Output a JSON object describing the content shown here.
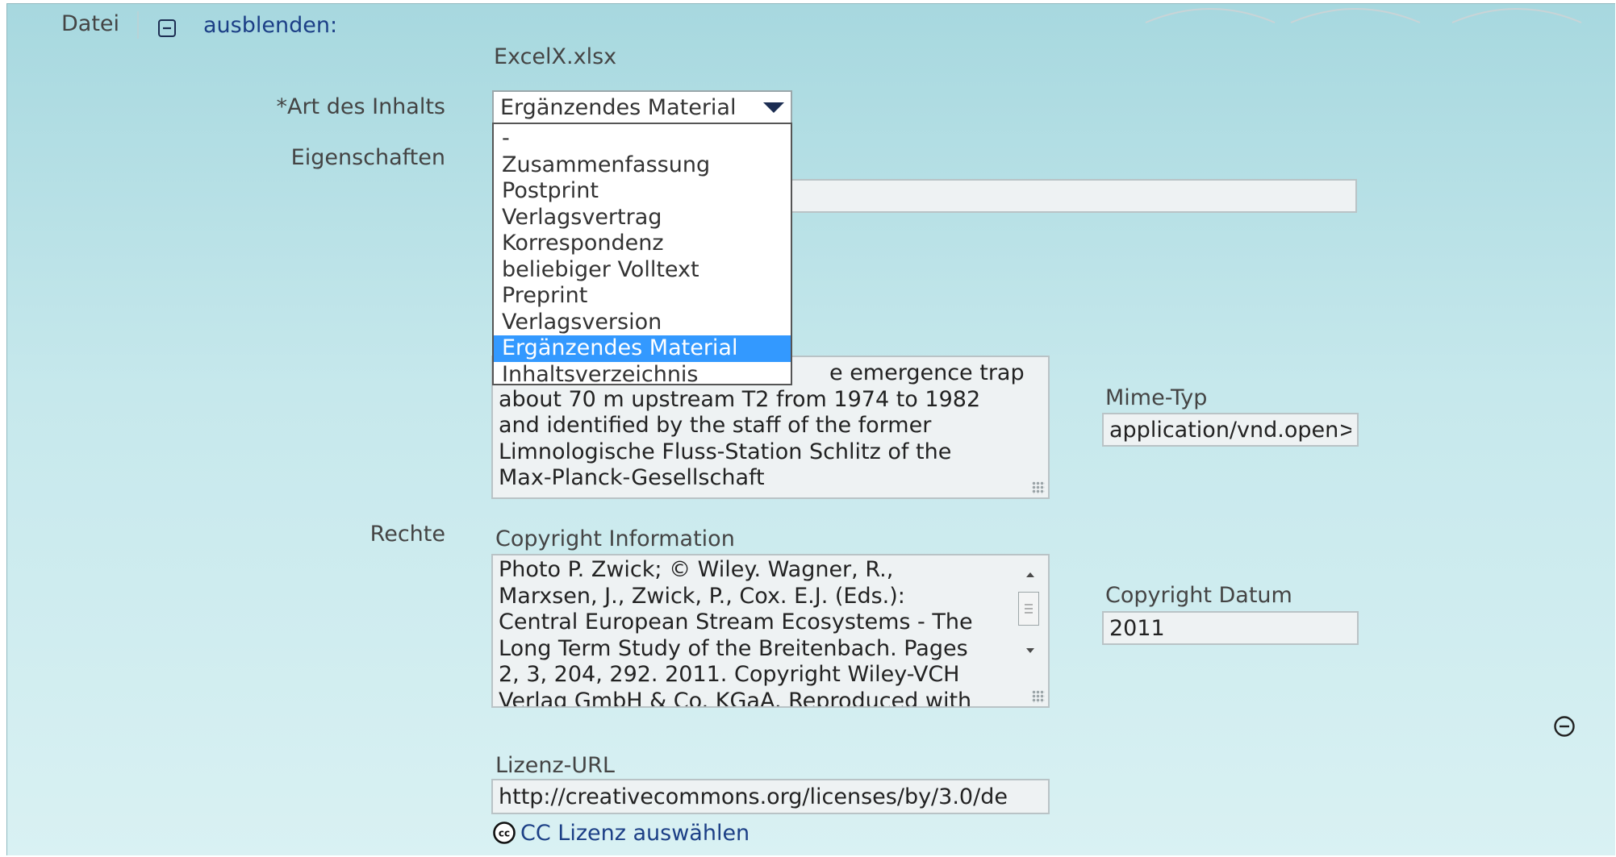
{
  "header": {
    "tab_label": "Datei",
    "toggle_label": "ausblenden:"
  },
  "file": {
    "name": "ExcelX.xlsx"
  },
  "content_type": {
    "label": "*Art des Inhalts",
    "selected": "Ergänzendes Material",
    "options": [
      "-",
      "Zusammenfassung",
      "Postprint",
      "Verlagsvertrag",
      "Korrespondenz",
      "beliebiger Volltext",
      "Preprint",
      "Verlagsversion",
      "Ergänzendes Material",
      "Inhaltsverzeichnis"
    ],
    "selected_index": 8
  },
  "properties": {
    "label": "Eigenschaften"
  },
  "description": {
    "visible_tail": "e emergence trap",
    "text": "about 70 m upstream T2 from 1974 to 1982\nand identified by the staff of the former\nLimnologische Fluss-Station Schlitz of the\nMax-Planck-Gesellschaft"
  },
  "mime": {
    "label": "Mime-Typ",
    "value": "application/vnd.open>"
  },
  "rights": {
    "label": "Rechte",
    "copyright_label": "Copyright Information",
    "copyright_text": "Photo P. Zwick; © Wiley. Wagner, R.,\nMarxsen, J., Zwick, P., Cox. E.J. (Eds.):\nCentral European Stream Ecosystems - The\nLong Term Study of the Breitenbach. Pages\n2, 3, 204, 292. 2011. Copyright Wiley-VCH\nVerlag GmbH & Co. KGaA. Reproduced with",
    "date_label": "Copyright Datum",
    "date_value": "2011",
    "license_label": "Lizenz-URL",
    "license_value": "http://creativecommons.org/licenses/by/3.0/de",
    "cc_badge": "cc",
    "cc_link": "CC Lizenz auswählen"
  },
  "icons": {
    "collapse": "minus-square-icon",
    "remove": "minus-circle-icon",
    "cc": "creative-commons-icon"
  },
  "colors": {
    "panel_gradient_top": "#a7d8df",
    "panel_gradient_bottom": "#d9f1f3",
    "selection": "#3399ff",
    "link": "#1c3f86"
  }
}
